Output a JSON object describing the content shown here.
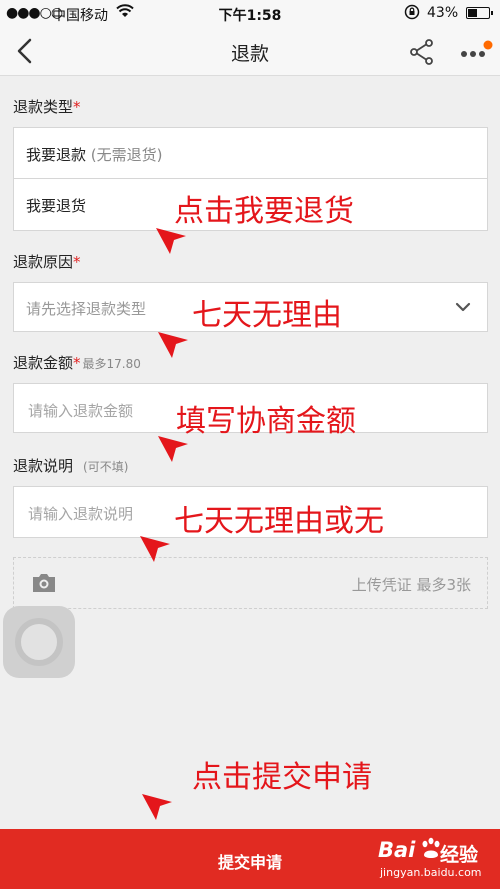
{
  "status_bar": {
    "signal": "●●●○○",
    "carrier": "中国移动",
    "time": "下午1:58",
    "battery": "43%"
  },
  "nav": {
    "title": "退款"
  },
  "refund_type": {
    "label": "退款类型",
    "required": "*",
    "option1_main": "我要退款",
    "option1_note": "(无需退货)",
    "option2": "我要退货"
  },
  "refund_reason": {
    "label": "退款原因",
    "required": "*",
    "placeholder": "请先选择退款类型"
  },
  "refund_amount": {
    "label": "退款金额",
    "required": "*",
    "hint": "最多17.80",
    "placeholder": "请输入退款金额"
  },
  "refund_desc": {
    "label": "退款说明",
    "hint": "(可不填)",
    "placeholder": "请输入退款说明"
  },
  "upload": {
    "text": "上传凭证 最多3张"
  },
  "annotations": {
    "a1": "点击我要退货",
    "a2": "七天无理由",
    "a3": "填写协商金额",
    "a4": "七天无理由或无",
    "a5": "点击提交申请"
  },
  "submit": {
    "label": "提交申请"
  },
  "watermark": {
    "logo": "Bai",
    "brand": "经验",
    "url": "jingyan.baidu.com"
  },
  "colors": {
    "accent": "#e12b22",
    "annotation": "#e4161b",
    "badge": "#ff6a00"
  }
}
